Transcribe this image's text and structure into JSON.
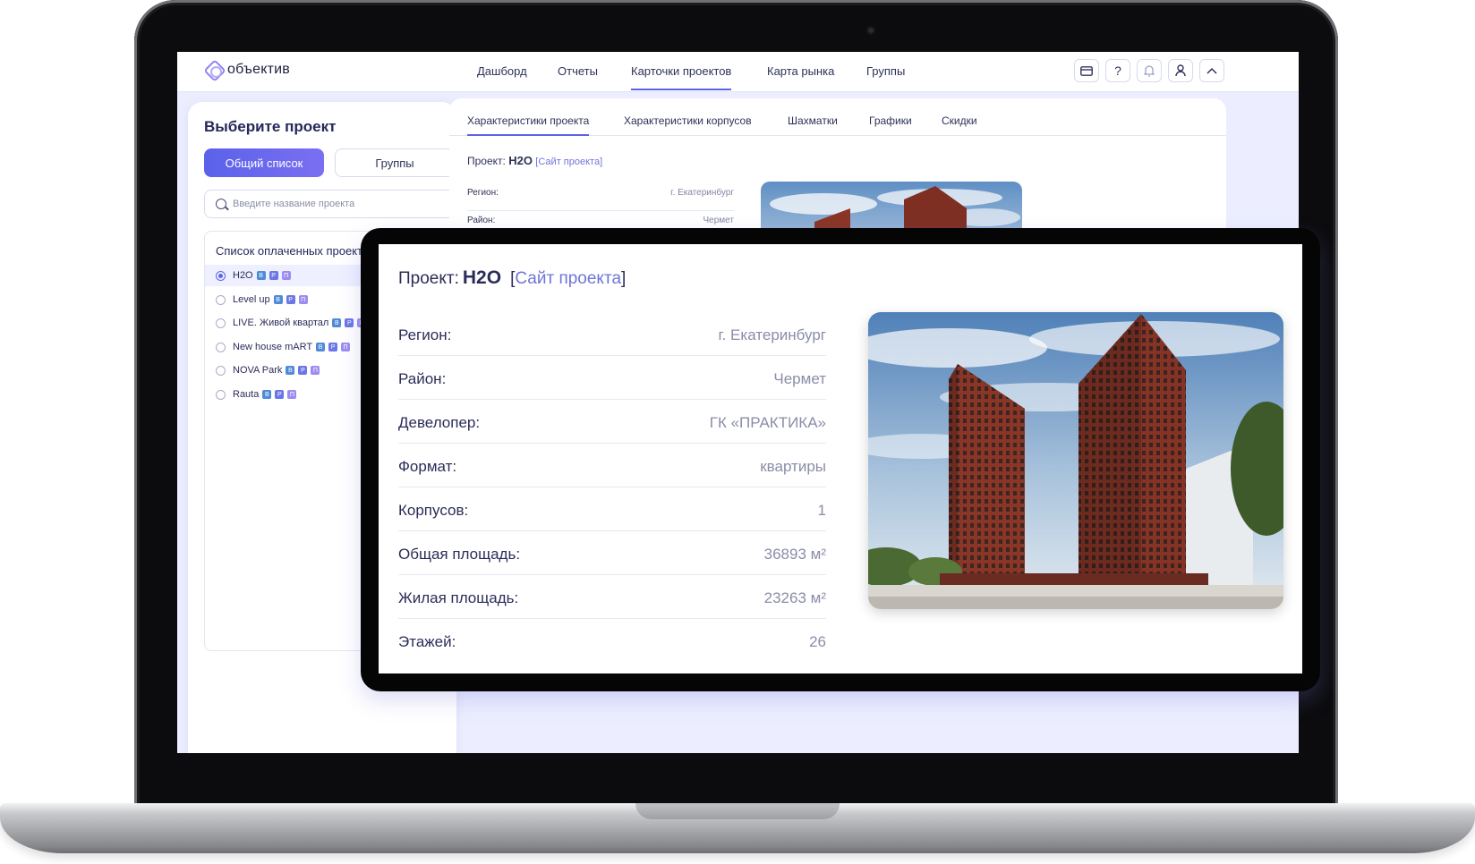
{
  "app": {
    "logo_text": "объектив"
  },
  "nav": [
    {
      "label": "Дашборд",
      "active": false
    },
    {
      "label": "Отчеты",
      "active": false
    },
    {
      "label": "Карточки проектов",
      "active": true
    },
    {
      "label": "Карта рынка",
      "active": false
    },
    {
      "label": "Группы",
      "active": false
    }
  ],
  "toolbar": {
    "icons": [
      "card-icon",
      "help-icon",
      "bell-icon",
      "user-icon",
      "chevron-up-icon"
    ],
    "help_glyph": "?"
  },
  "sidebar": {
    "title": "Выберите проект",
    "btn_all": "Общий список",
    "btn_groups": "Группы",
    "search_placeholder": "Введите название проекта",
    "list_title": "Список оплаченных проектов",
    "tags": {
      "b": "В",
      "p": "Р",
      "s": "П"
    },
    "projects": [
      {
        "name": "H2O",
        "selected": true
      },
      {
        "name": "Level up",
        "selected": false
      },
      {
        "name": "LIVE. Живой квартал",
        "selected": false
      },
      {
        "name": "New house mART",
        "selected": false
      },
      {
        "name": "NOVA Park",
        "selected": false
      },
      {
        "name": "Rauta",
        "selected": false
      }
    ]
  },
  "tabs": [
    {
      "label": "Характеристики проекта",
      "active": true
    },
    {
      "label": "Характеристики корпусов",
      "active": false
    },
    {
      "label": "Шахматки",
      "active": false
    },
    {
      "label": "Графики",
      "active": false
    },
    {
      "label": "Скидки",
      "active": false
    }
  ],
  "project": {
    "prefix": "Проект:",
    "name": "H2O",
    "site_link": "Сайт проекта",
    "bracket_open": "[",
    "bracket_close": "]",
    "fields": [
      {
        "key": "Регион:",
        "value": "г. Екатеринбург"
      },
      {
        "key": "Район:",
        "value": "Чермет"
      },
      {
        "key": "Девелопер:",
        "value": "ГК «ПРАКТИКА»"
      },
      {
        "key": "Формат:",
        "value": "квартиры"
      },
      {
        "key": "Корпусов:",
        "value": "1"
      },
      {
        "key": "Общая площадь:",
        "value": "36893 м²"
      },
      {
        "key": "Жилая площадь:",
        "value": "23263 м²"
      },
      {
        "key": "Этажей:",
        "value": "26"
      }
    ]
  },
  "colors": {
    "accent": "#5b63e8",
    "link": "#6f74d8",
    "text": "#2b2d59",
    "muted": "#8a8da8",
    "building": "#8a3526"
  }
}
